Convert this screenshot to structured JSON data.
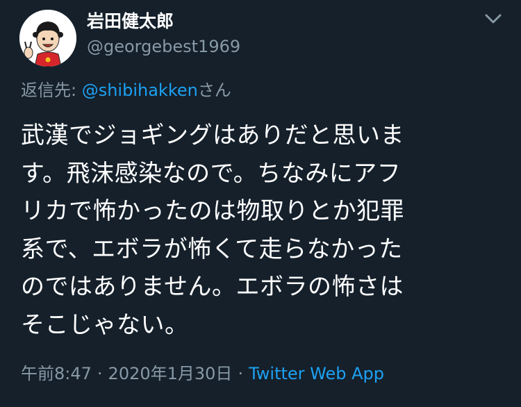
{
  "author": {
    "display_name": "岩田健太郎",
    "handle": "@georgebest1969",
    "avatar_icon": "cartoon-character-avatar-icon"
  },
  "more_icon": "chevron-down-icon",
  "reply": {
    "prefix": "返信先: ",
    "mention": "@shibihakken",
    "suffix": "さん"
  },
  "tweet": {
    "lines": [
      "武漢でジョギングはありだと思いま",
      "す。飛沫感染なので。ちなみにアフ",
      "リカで怖かったのは物取りとか犯罪",
      "系で、エボラが怖くて走らなかった",
      "のではありません。エボラの怖さは",
      "そこじゃない。"
    ]
  },
  "meta": {
    "time": "午前8:47",
    "separator": "·",
    "date": "2020年1月30日",
    "source": "Twitter Web App"
  },
  "colors": {
    "background": "#15202b",
    "primary_text": "#ffffff",
    "secondary_text": "#8899a6",
    "link": "#1da1f2"
  }
}
